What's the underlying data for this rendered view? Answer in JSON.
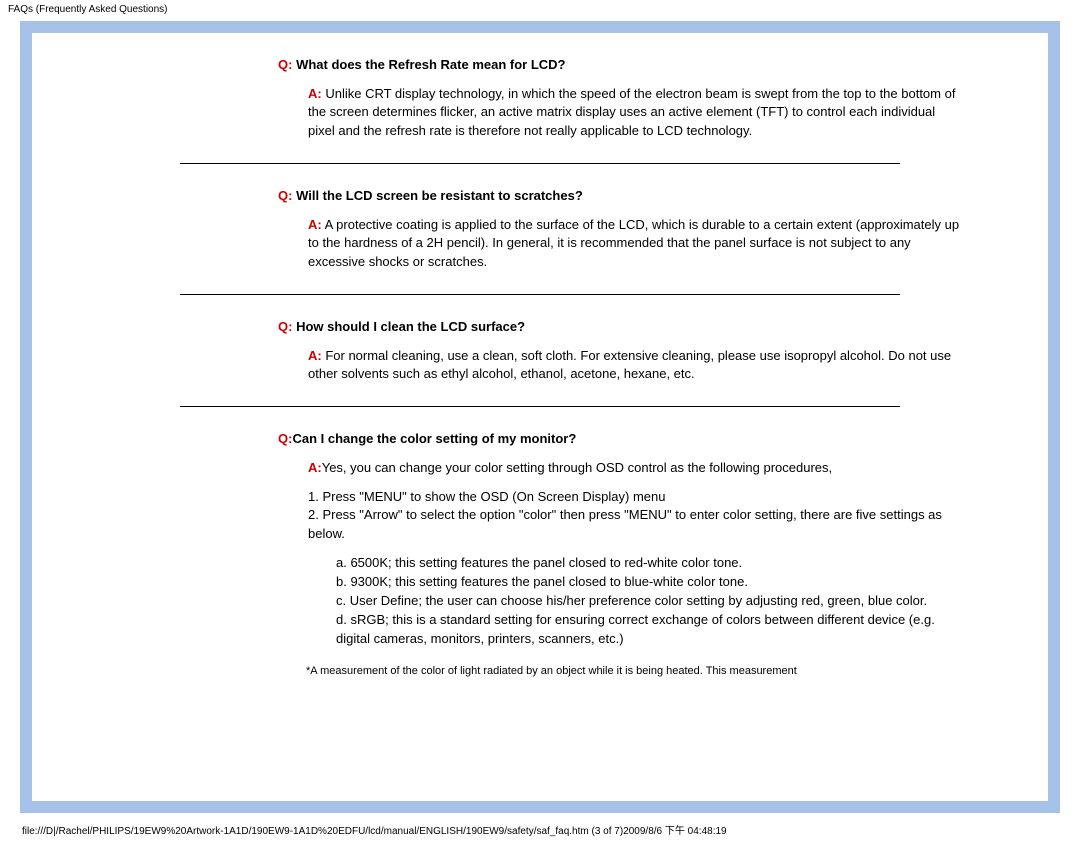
{
  "header": {
    "title": "FAQs (Frequently Asked Questions)"
  },
  "faqs": [
    {
      "q_label": "Q:",
      "q_text": " What does the Refresh Rate mean for LCD?",
      "a_label": "A:",
      "a_text": " Unlike CRT display technology, in which the speed of the electron beam is swept from the top to the bottom of the screen determines flicker, an active matrix display uses an active element (TFT) to control each individual pixel and the refresh rate is therefore not really applicable to LCD technology."
    },
    {
      "q_label": "Q:",
      "q_text": " Will the LCD screen be resistant to scratches?",
      "a_label": "A:",
      "a_text": " A protective coating is applied to the surface of the LCD, which is durable to a certain extent (approximately up to the hardness of a 2H pencil). In general, it is recommended that the panel surface is not subject to any excessive shocks or scratches."
    },
    {
      "q_label": "Q:",
      "q_text": " How should I clean the LCD surface?",
      "a_label": "A:",
      "a_text": " For normal cleaning, use a clean, soft cloth. For extensive cleaning, please use isopropyl alcohol. Do not use other solvents such as ethyl alcohol, ethanol, acetone, hexane, etc."
    },
    {
      "q_label": "Q:",
      "q_text": "Can I change the color setting of my monitor?",
      "a_label": "A:",
      "a_text": "Yes, you can change your color setting through OSD control as the following procedures,",
      "steps": "1. Press \"MENU\" to show the OSD (On Screen Display) menu\n2. Press \"Arrow\" to select the option \"color\" then press \"MENU\" to enter color setting, there are five settings as below.",
      "sublist": "a. 6500K; this setting features the panel closed to red-white color tone.\nb. 9300K; this setting features the panel closed to blue-white color tone.\nc. User Define; the user can choose his/her preference color setting by adjusting red, green, blue color.\nd. sRGB; this is a standard setting for ensuring correct exchange of colors between different device (e.g. digital cameras, monitors, printers, scanners, etc.)",
      "footnote": "*A measurement of the color of light radiated by an object while it is being heated. This measurement"
    }
  ],
  "footer": {
    "path": "file:///D|/Rachel/PHILIPS/19EW9%20Artwork-1A1D/190EW9-1A1D%20EDFU/lcd/manual/ENGLISH/190EW9/safety/saf_faq.htm (3 of 7)2009/8/6 下午 04:48:19"
  }
}
